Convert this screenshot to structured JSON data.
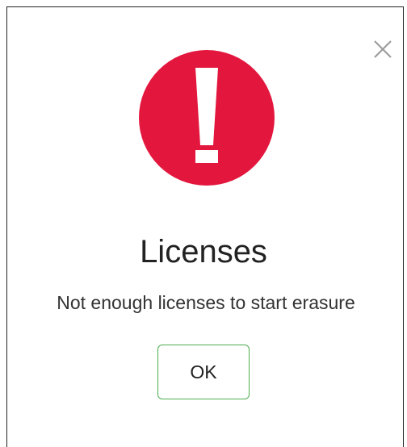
{
  "dialog": {
    "title": "Licenses",
    "message": "Not enough licenses to start erasure",
    "ok_label": "OK",
    "close_icon": "close-icon",
    "alert_icon": "exclamation-icon",
    "colors": {
      "alert_red": "#e3173e",
      "ok_border": "#4caf50",
      "close_icon": "#9a9a9a"
    }
  }
}
